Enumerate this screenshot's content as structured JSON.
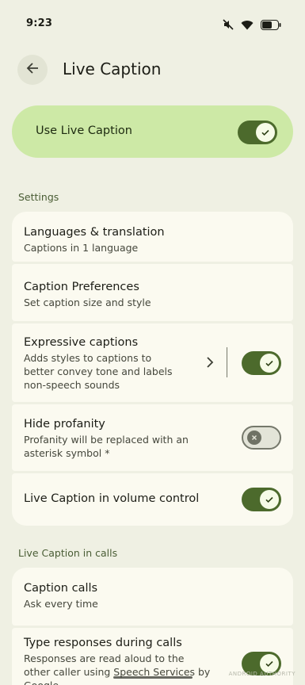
{
  "status_bar": {
    "time": "9:23"
  },
  "header": {
    "title": "Live Caption"
  },
  "master": {
    "label": "Use Live Caption",
    "enabled": true
  },
  "settings": {
    "section_label": "Settings",
    "items": [
      {
        "title": "Languages & translation",
        "subtitle": "Captions in 1 language"
      },
      {
        "title": "Caption Preferences",
        "subtitle": "Set caption size and style"
      },
      {
        "title": "Expressive captions",
        "subtitle_lines": [
          "Adds styles to captions to",
          "better convey tone and labels",
          "non-speech sounds"
        ],
        "enabled": true
      },
      {
        "title": "Hide profanity",
        "subtitle_lines": [
          "Profanity will be replaced with an",
          "asterisk symbol *"
        ],
        "enabled": false
      },
      {
        "title": "Live Caption in volume control",
        "enabled": true
      }
    ]
  },
  "calls": {
    "section_label": "Live Caption in calls",
    "items": [
      {
        "title": "Caption calls",
        "subtitle": "Ask every time"
      },
      {
        "title": "Type responses during calls",
        "subtitle_lines": [
          "Responses are read aloud to the",
          "other caller using Speech Services by",
          "Google"
        ],
        "enabled": true
      }
    ]
  },
  "watermark": "ANDROID AUTHORITY",
  "colors": {
    "accent": "#4c6a2c",
    "master_bg": "#cde9a6",
    "background": "#eff0e3",
    "card": "#fbfaf0"
  }
}
